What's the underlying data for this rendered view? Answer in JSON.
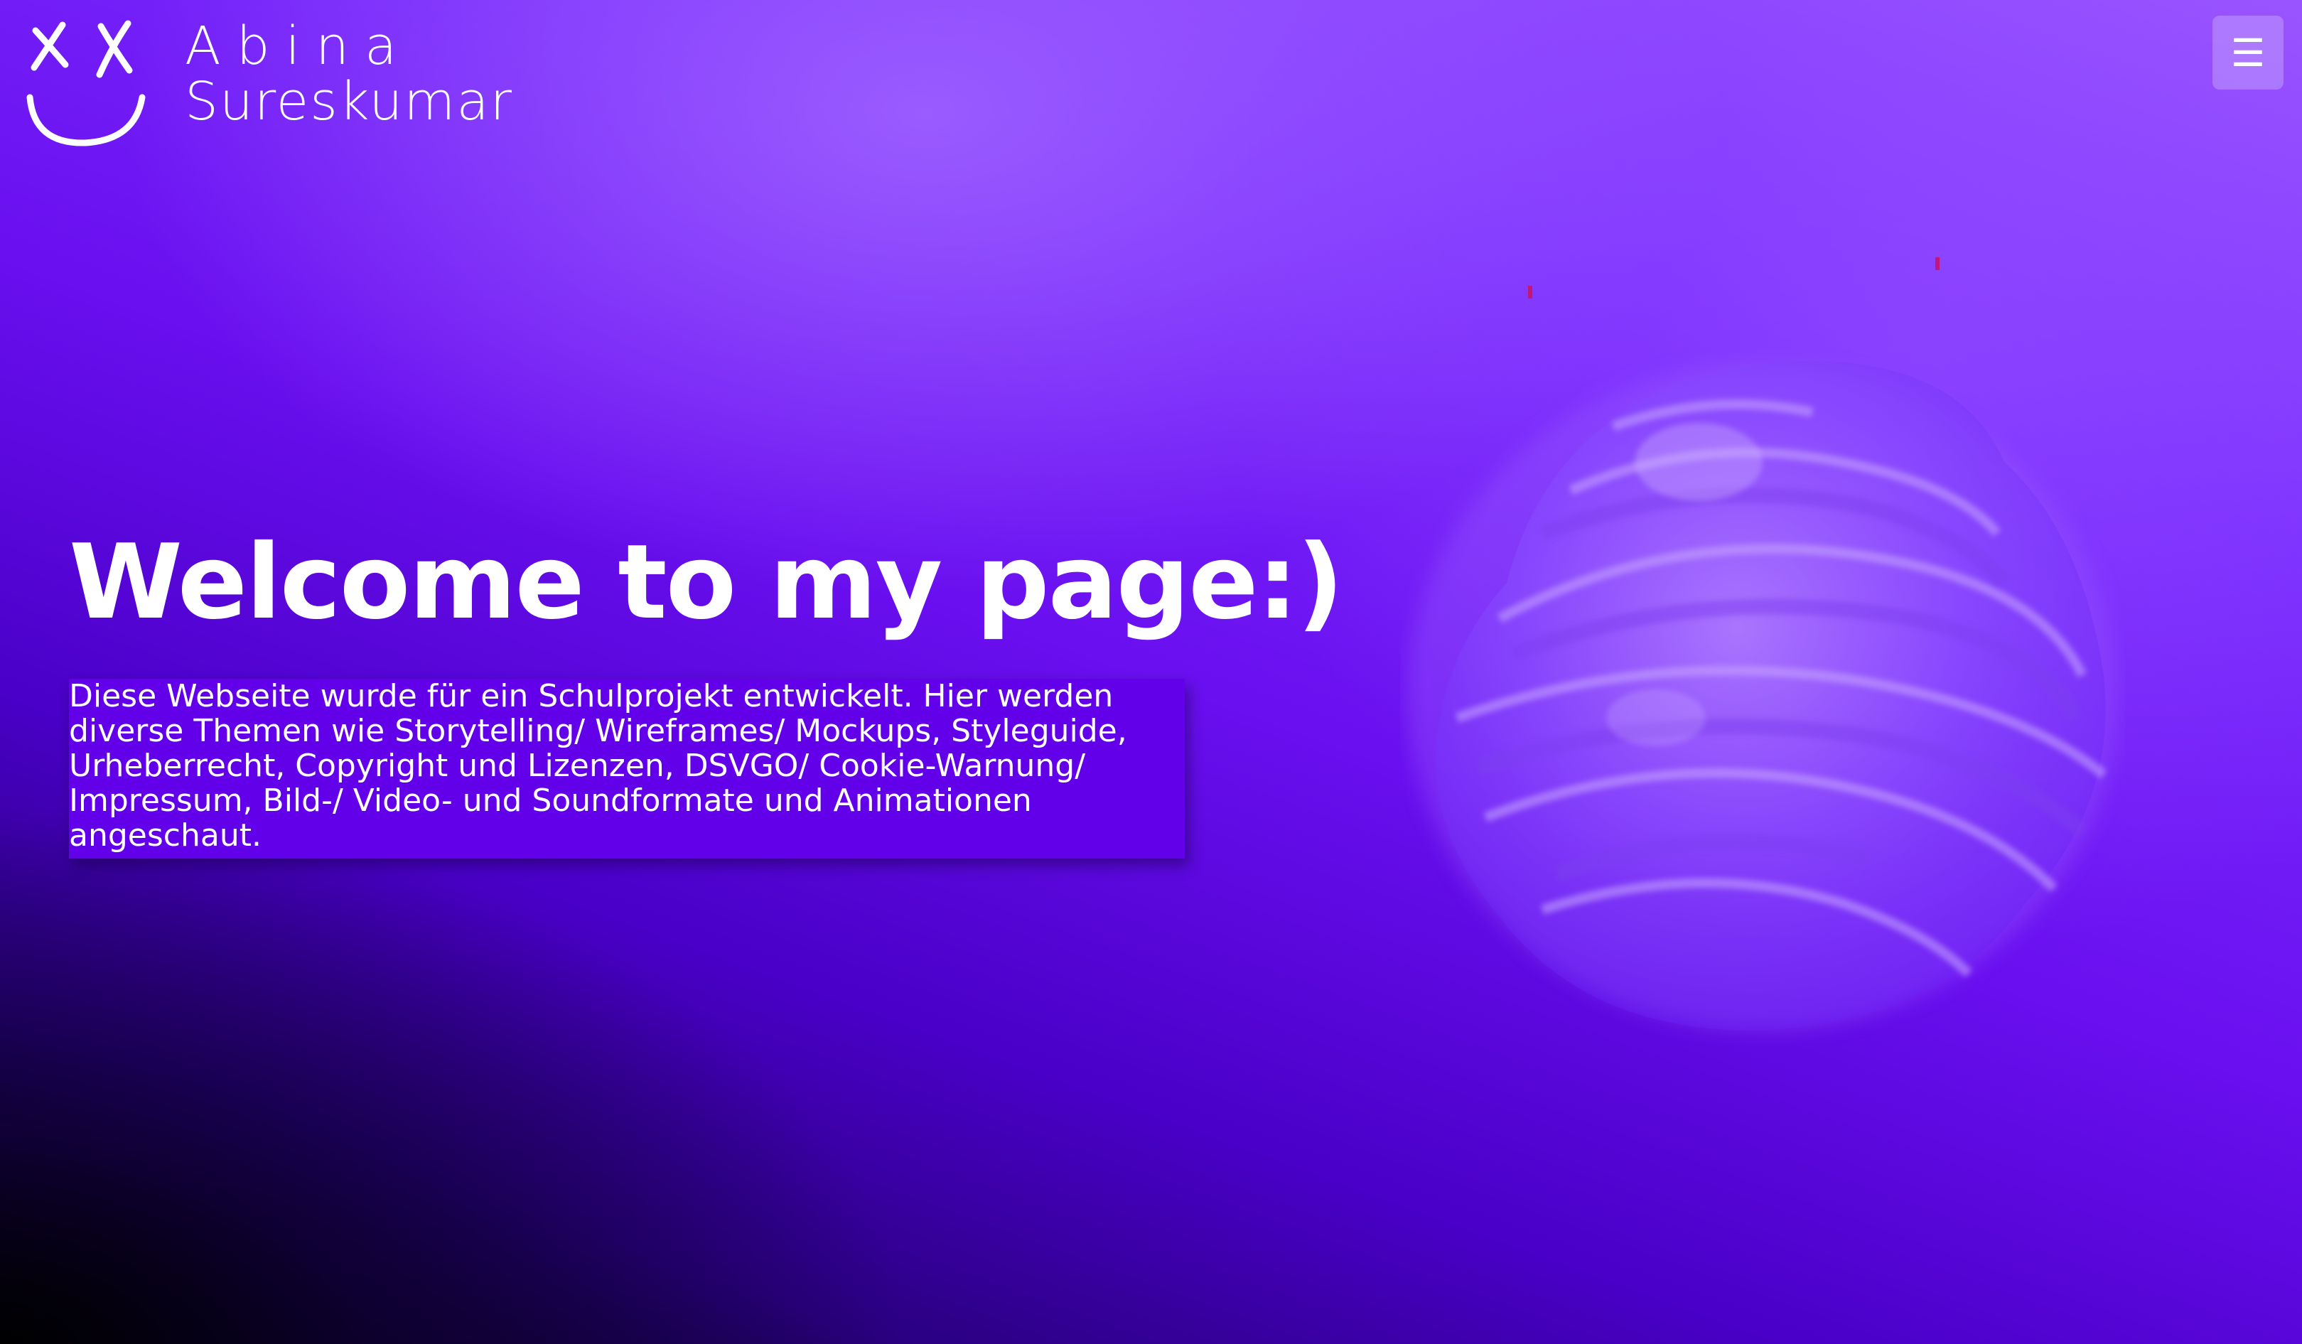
{
  "header": {
    "logo_first_name": "Abina",
    "logo_last_name": "Sureskumar",
    "logo_icon": "smiley-face-icon",
    "menu_icon": "hamburger-menu-icon",
    "menu_glyph": "☰"
  },
  "hero": {
    "title": "Welcome to my page:)",
    "description": "Diese Webseite wurde für ein Schulprojekt entwickelt. Hier werden diverse Themen wie Storytelling/ Wireframes/ Mockups, Styleguide, Urheberrecht, Copyright und Lizenzen, DSVGO/ Cookie-Warnung/ Impressum, Bild-/ Video- und Soundformate und Animationen angeschaut."
  },
  "theme": {
    "accent": "#7a2dff",
    "background_dark": "#000000",
    "text_box_bg": "#6200ea",
    "text": "#ffffff"
  }
}
